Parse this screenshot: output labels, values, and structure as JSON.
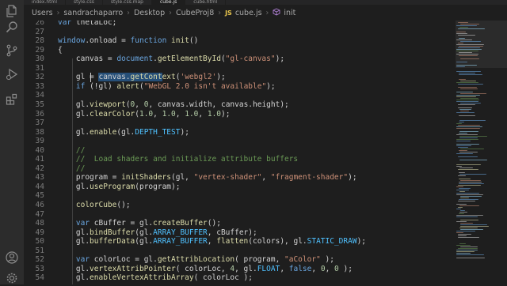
{
  "tabs": [
    {
      "label": "index.html",
      "active": false
    },
    {
      "label": "style.css",
      "active": false
    },
    {
      "label": "style.css.map",
      "active": false
    },
    {
      "label": "cube.js",
      "active": true
    },
    {
      "label": "cube.html",
      "active": false
    }
  ],
  "breadcrumb": {
    "parts": [
      "Users",
      "sandrachaparro",
      "Desktop",
      "CubeProj8"
    ],
    "file_badge": "JS",
    "file": "cube.js",
    "function_icon": "cube-function-icon",
    "function": "init"
  },
  "activity_icons": [
    "files-icon",
    "search-icon",
    "source-control-icon",
    "run-debug-icon",
    "extensions-icon",
    "account-icon",
    "settings-gear-icon"
  ],
  "editor": {
    "lines": [
      {
        "n": "26",
        "segs": []
      },
      {
        "n": "27",
        "segs": []
      },
      {
        "n": "28",
        "segs": []
      },
      {
        "n": "29",
        "segs": []
      },
      {
        "n": "30",
        "segs": []
      },
      {
        "n": "31",
        "segs": []
      },
      {
        "n": "32",
        "segs": []
      },
      {
        "n": "33",
        "segs": []
      },
      {
        "n": "34",
        "segs": []
      },
      {
        "n": "35",
        "segs": []
      },
      {
        "n": "36",
        "segs": []
      },
      {
        "n": "37",
        "segs": []
      },
      {
        "n": "38",
        "segs": []
      },
      {
        "n": "39",
        "segs": []
      },
      {
        "n": "40",
        "segs": []
      },
      {
        "n": "41",
        "segs": []
      },
      {
        "n": "42",
        "segs": []
      },
      {
        "n": "43",
        "segs": []
      },
      {
        "n": "44",
        "segs": []
      },
      {
        "n": "45",
        "segs": []
      },
      {
        "n": "46",
        "segs": []
      },
      {
        "n": "47",
        "segs": []
      },
      {
        "n": "48",
        "segs": []
      },
      {
        "n": "49",
        "segs": []
      },
      {
        "n": "50",
        "segs": []
      },
      {
        "n": "51",
        "segs": []
      },
      {
        "n": "52",
        "segs": []
      },
      {
        "n": "53",
        "segs": []
      },
      {
        "n": "54",
        "segs": []
      }
    ],
    "code": [
      "var thetaLoc;",
      "",
      "window.onload = function init()",
      "{",
      "    canvas = document.getElementById(\"gl-canvas\");",
      "",
      "    gl = canvas.getContext('webgl2');",
      "    if (!gl) alert(\"WebGL 2.0 isn't available\");",
      "",
      "    gl.viewport(0, 0, canvas.width, canvas.height);",
      "    gl.clearColor(1.0, 1.0, 1.0, 1.0);",
      "",
      "    gl.enable(gl.DEPTH_TEST);",
      "",
      "    //",
      "    //  Load shaders and initialize attribute buffers",
      "    //",
      "    program = initShaders(gl, \"vertex-shader\", \"fragment-shader\");",
      "    gl.useProgram(program);",
      "",
      "    colorCube();",
      "",
      "    var cBuffer = gl.createBuffer();",
      "    gl.bindBuffer(gl.ARRAY_BUFFER, cBuffer);",
      "    gl.bufferData(gl.ARRAY_BUFFER, flatten(colors), gl.STATIC_DRAW);",
      "",
      "    var colorLoc = gl.getAttribLocation( program, \"aColor\" );",
      "    gl.vertexAttribPointer( colorLoc, 4, gl.FLOAT, false, 0, 0 );",
      "    gl.enableVertexAttribArray( colorLoc );"
    ],
    "highlight_selection": "canvas.getContext"
  },
  "colors": {
    "keyword": "#6aa6e0",
    "string": "#ce9178",
    "comment": "#6a9955",
    "number": "#b5cea8",
    "background": "#1e1e1e"
  }
}
